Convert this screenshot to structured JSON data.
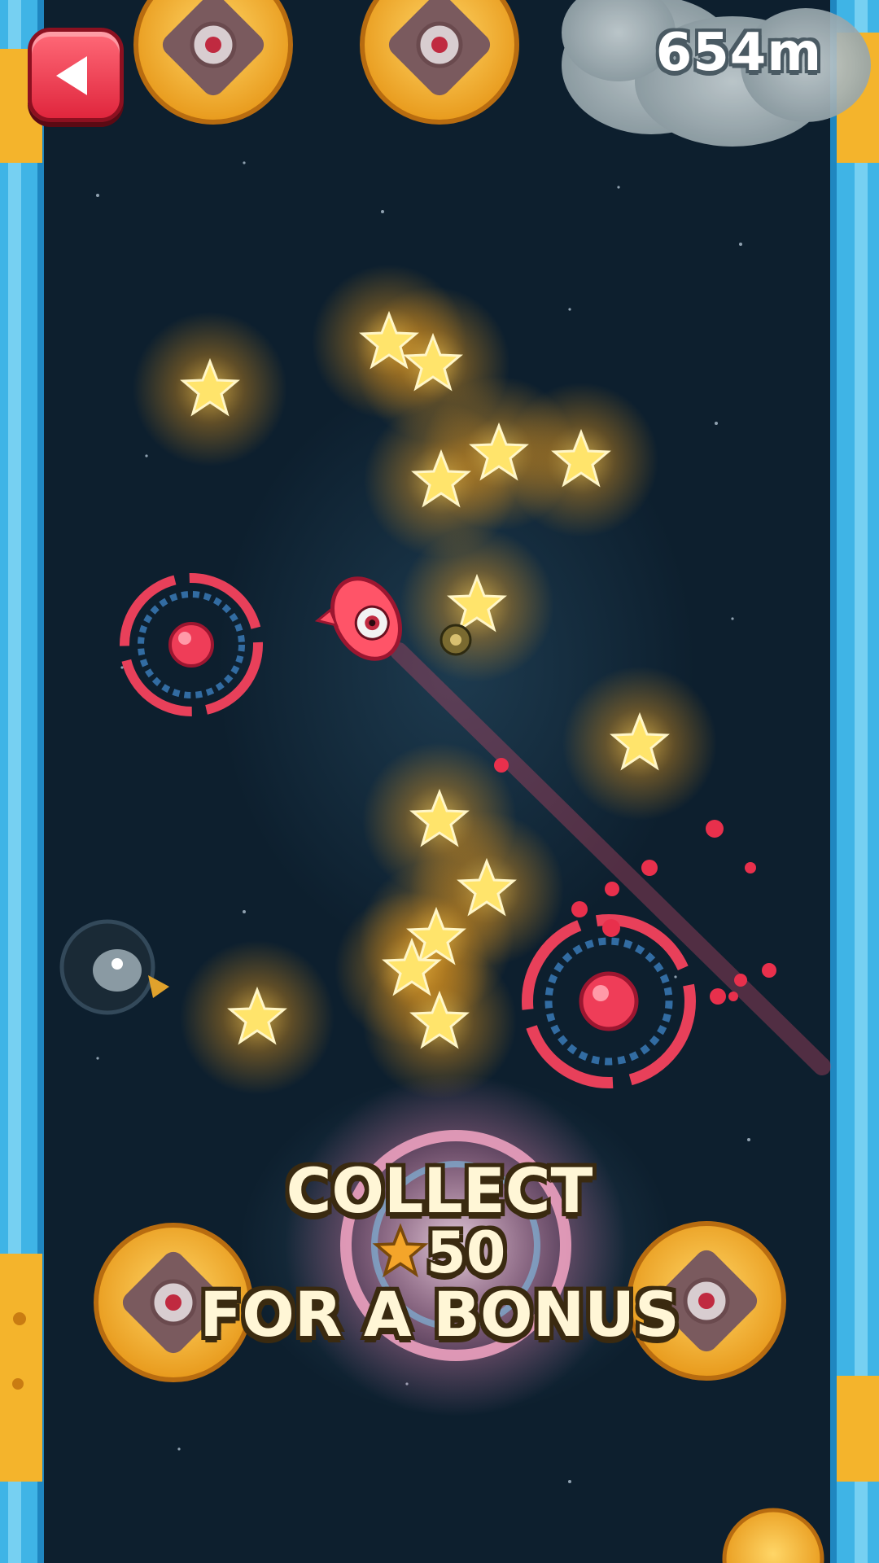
{
  "hud": {
    "distance": "654m",
    "back_button_label": "back"
  },
  "prompt": {
    "line1": "COLLECT",
    "count": "50",
    "line3": "FOR A BONUS"
  },
  "colors": {
    "background": "#0d1f2e",
    "star": "#ffe46b",
    "star_glow": "#f7a21a",
    "player": "#ff5468",
    "bumper": "#e8405a",
    "ice_wall": "#5cc8f0",
    "cheese_wall": "#f4b42c"
  },
  "icons": {
    "back": "back-arrow-icon",
    "collectible": "star-icon",
    "player": "red-monster-icon"
  }
}
